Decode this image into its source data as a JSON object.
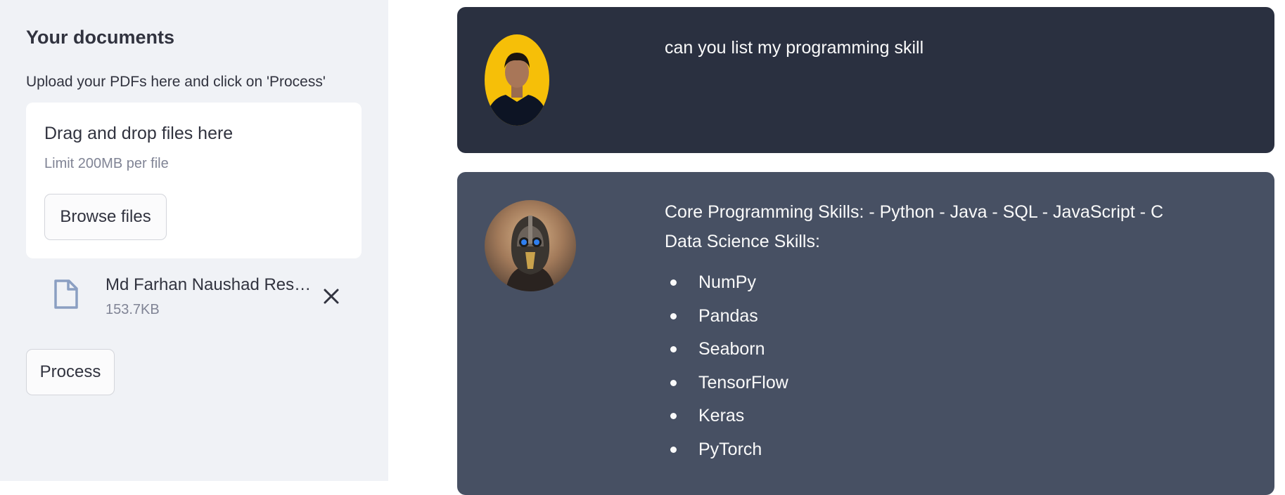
{
  "sidebar": {
    "title": "Your documents",
    "subtitle": "Upload your PDFs here and click on 'Process'",
    "uploader": {
      "drop_label": "Drag and drop files here",
      "limit_label": "Limit 200MB per file",
      "browse_label": "Browse files"
    },
    "file": {
      "icon": "file-icon",
      "name": "Md Farhan Naushad Resume.pdf",
      "size": "153.7KB"
    },
    "process_label": "Process"
  },
  "chat": {
    "user_message": {
      "text": "can you list my programming skill"
    },
    "bot_message": {
      "line1": "Core Programming Skills: - Python - Java - SQL - JavaScript - C",
      "line2": "Data Science Skills:",
      "items": [
        "NumPy",
        "Pandas",
        "Seaborn",
        "TensorFlow",
        "Keras",
        "PyTorch"
      ]
    }
  },
  "colors": {
    "sidebar_bg": "#f0f2f6",
    "user_bubble": "#2a3040",
    "bot_bubble": "#475063",
    "user_avatar_bg": "#f6bf08"
  }
}
